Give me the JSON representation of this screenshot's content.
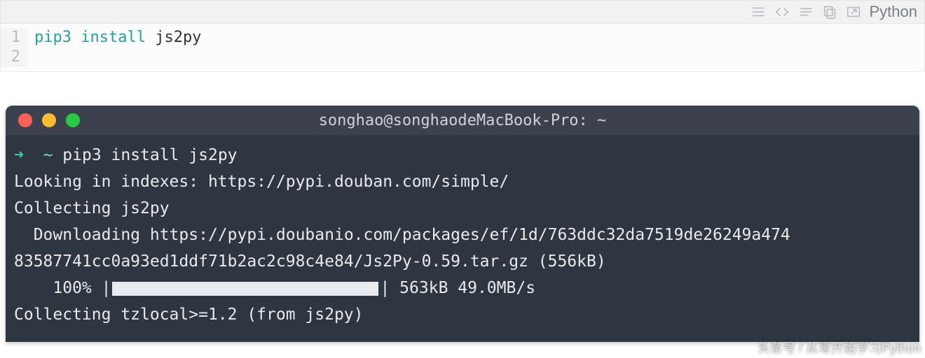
{
  "codeblock": {
    "language": "Python",
    "toolbar_icons": [
      "menu-icon",
      "code-icon",
      "lines-icon",
      "copy-icon",
      "popout-icon"
    ],
    "gutter": [
      "1",
      "2"
    ],
    "tokens": {
      "cmd1": "pip3",
      "cmd2": "install",
      "arg": "js2py"
    }
  },
  "terminal": {
    "title": "songhao@songhaodeMacBook-Pro: ~",
    "prompt_arrow": "➜",
    "prompt_path": "~",
    "command": "pip3 install js2py",
    "lines": {
      "l1": "Looking in indexes: https://pypi.douban.com/simple/",
      "l2": "Collecting js2py",
      "l3a": "  Downloading https://pypi.doubanio.com/packages/ef/1d/763ddc32da7519de26249a474",
      "l3b": "83587741cc0a93ed1ddf71b2ac2c98c4e84/Js2Py-0.59.tar.gz (556kB)",
      "l4_pct": "    100% |",
      "l4_end": "| 563kB 49.0MB/s",
      "l5": "Collecting tzlocal>=1.2 (from js2py)"
    }
  },
  "watermark": "头条号 / 从零开始学习Python"
}
